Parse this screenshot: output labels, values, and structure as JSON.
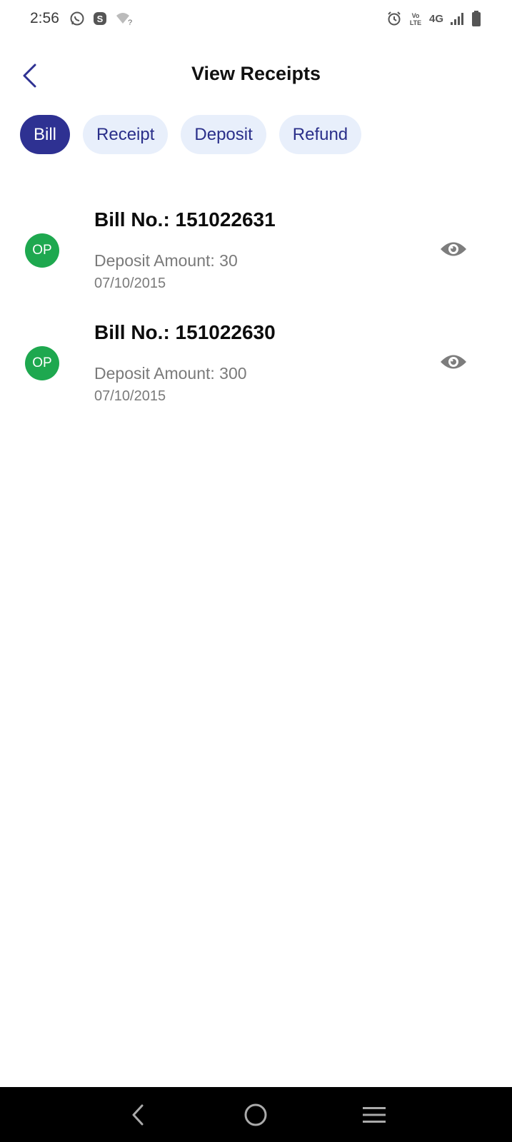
{
  "status_bar": {
    "time": "2:56",
    "network_label": "4G",
    "volte_label": "VoLTE"
  },
  "header": {
    "title": "View Receipts"
  },
  "tabs": [
    {
      "label": "Bill",
      "active": true
    },
    {
      "label": "Receipt",
      "active": false
    },
    {
      "label": "Deposit",
      "active": false
    },
    {
      "label": "Refund",
      "active": false
    }
  ],
  "receipts": [
    {
      "avatar": "OP",
      "bill_no": "Bill No.: 151022631",
      "deposit": "Deposit Amount: 30",
      "date": "07/10/2015"
    },
    {
      "avatar": "OP",
      "bill_no": "Bill No.: 151022630",
      "deposit": "Deposit Amount: 300",
      "date": "07/10/2015"
    }
  ],
  "icons": {
    "back": "chevron-left-icon",
    "view": "eye-icon",
    "nav_back": "back-icon",
    "nav_home": "home-icon",
    "nav_menu": "menu-icon"
  },
  "colors": {
    "accent": "#2e3192",
    "tab_inactive_bg": "#e8effb",
    "avatar_bg": "#1ea84f",
    "muted_text": "#7a7a7a"
  }
}
